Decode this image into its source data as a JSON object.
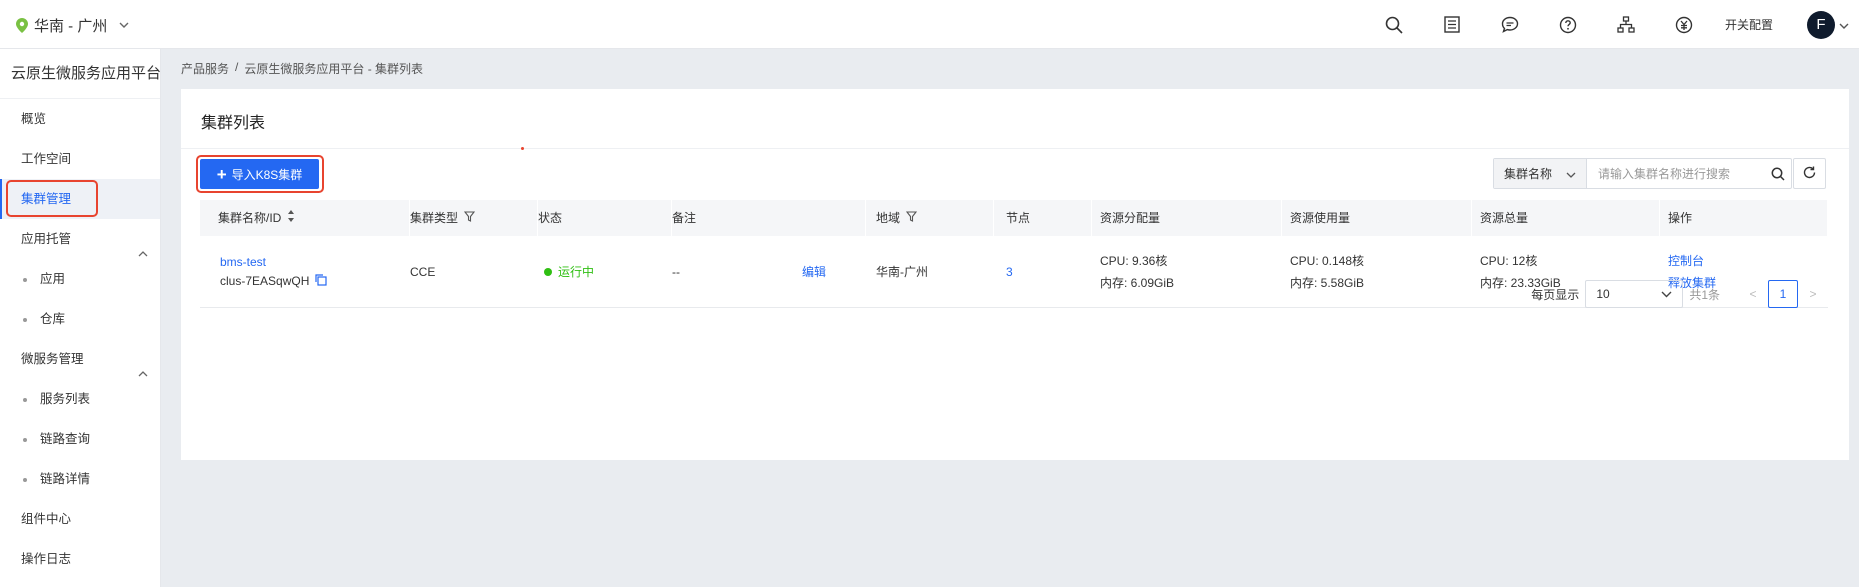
{
  "header": {
    "region": "华南 - 广州",
    "region_icon": "location-pin-icon",
    "icons": [
      "search-icon",
      "document-list-icon",
      "message-icon",
      "help-icon",
      "org-chart-icon",
      "billing-icon"
    ],
    "switch_config": "开关配置",
    "avatar_initial": "F"
  },
  "sidebar": {
    "title": "云原生微服务应用平台",
    "items": [
      {
        "label": "概览"
      },
      {
        "label": "工作空间"
      },
      {
        "label": "集群管理"
      },
      {
        "label": "应用托管"
      },
      {
        "label": "应用"
      },
      {
        "label": "仓库"
      },
      {
        "label": "微服务管理"
      },
      {
        "label": "服务列表"
      },
      {
        "label": "链路查询"
      },
      {
        "label": "链路详情"
      },
      {
        "label": "组件中心"
      },
      {
        "label": "操作日志"
      }
    ],
    "active_item": "集群管理"
  },
  "breadcrumb": {
    "items": [
      "产品服务",
      "/",
      "云原生微服务应用平台 - 集群列表"
    ]
  },
  "main": {
    "title": "集群列表",
    "import_button": "导入K8S集群",
    "search": {
      "field": "集群名称",
      "placeholder": "请输入集群名称进行搜索"
    },
    "table": {
      "columns": [
        "集群名称/ID",
        "集群类型",
        "状态",
        "备注",
        "地域",
        "节点",
        "资源分配量",
        "资源使用量",
        "资源总量",
        "操作"
      ],
      "rows": [
        {
          "name": "bms-test",
          "id": "clus-7EASqwQH",
          "type": "CCE",
          "status": "运行中",
          "remark": "--",
          "remark_action": "编辑",
          "region": "华南-广州",
          "nodes": "3",
          "alloc_cpu": "CPU: 9.36核",
          "alloc_mem": "内存: 6.09GiB",
          "used_cpu": "CPU: 0.148核",
          "used_mem": "内存: 5.58GiB",
          "total_cpu": "CPU: 12核",
          "total_mem": "内存: 23.33GiB",
          "actions": [
            "控制台",
            "释放集群"
          ]
        }
      ]
    },
    "pagination": {
      "page_size_label": "每页显示",
      "page_size": "10",
      "total": "共1条",
      "prev": "<",
      "current": "1",
      "next": ">"
    }
  },
  "colors": {
    "primary": "#2468f2",
    "status_running": "#30bf13",
    "highlight": "#e8442f"
  }
}
